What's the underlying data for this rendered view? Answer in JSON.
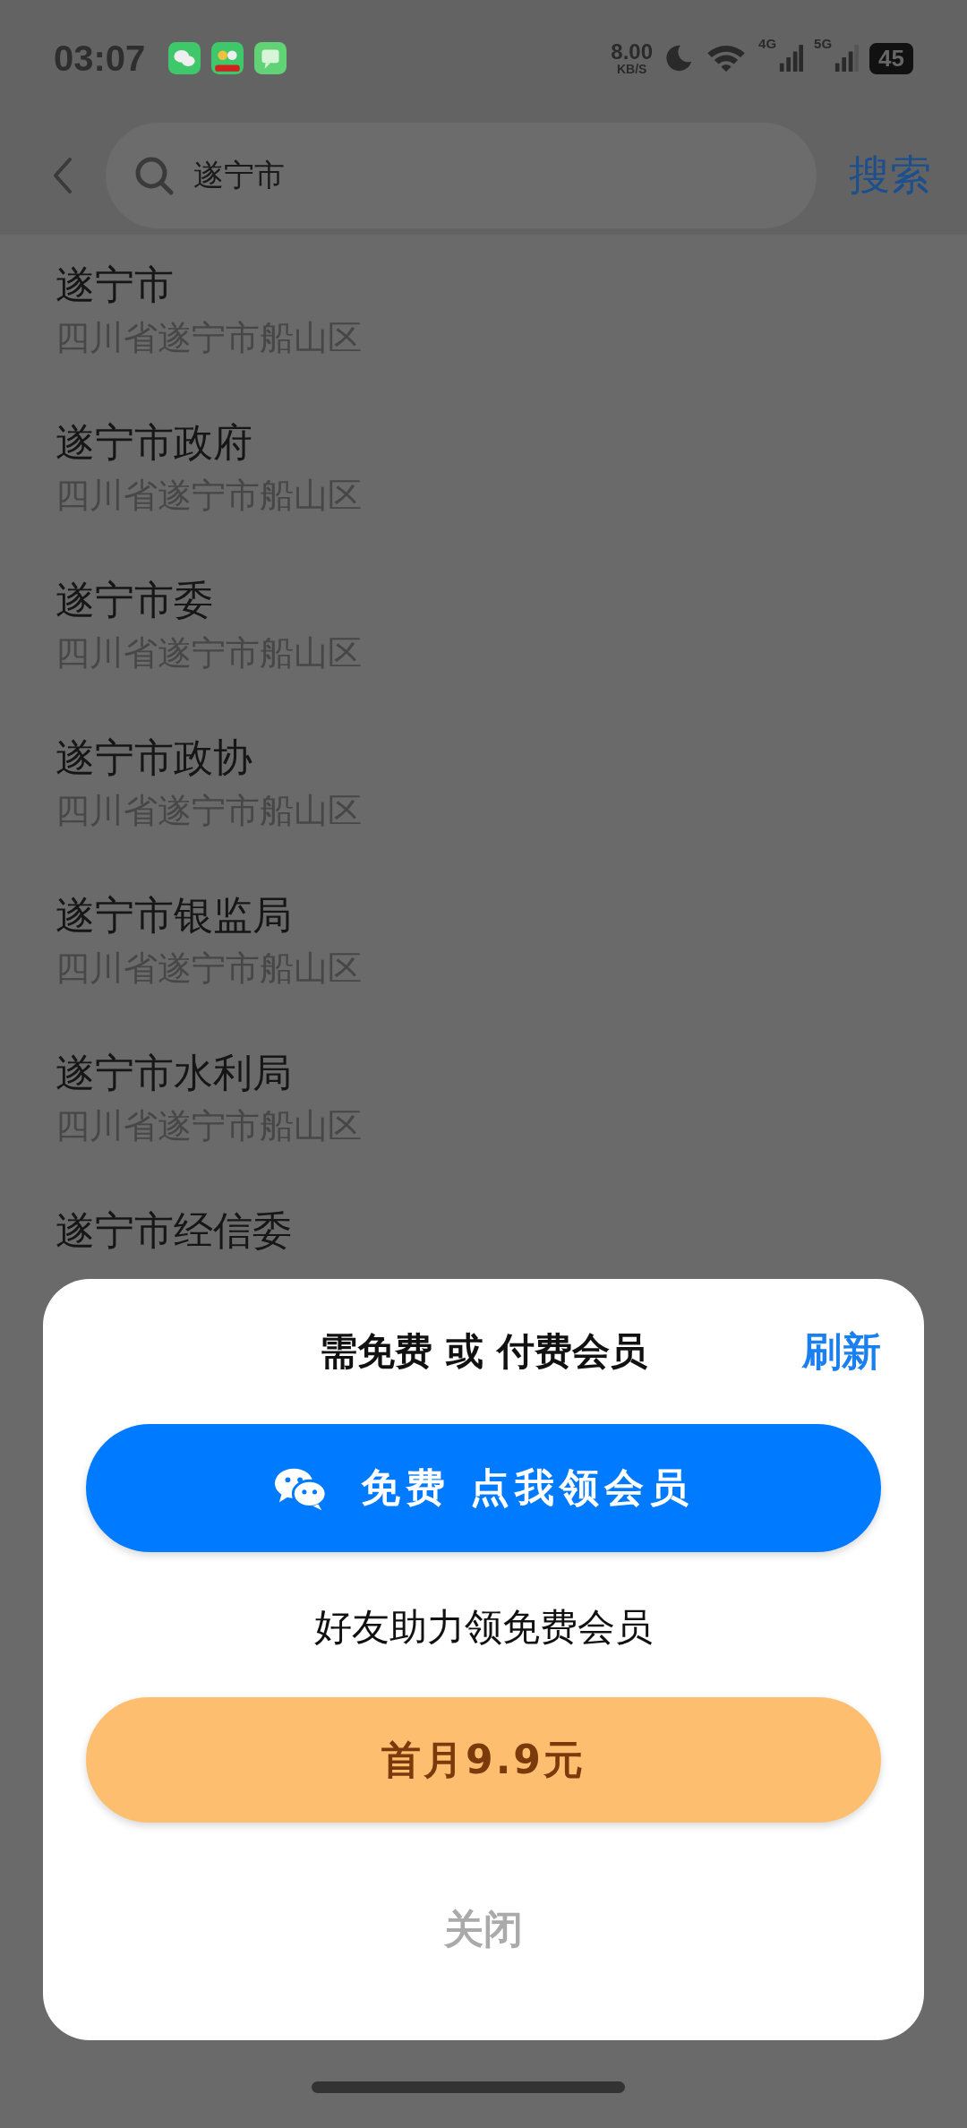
{
  "status_bar": {
    "time": "03:07",
    "speed": "8.00",
    "speed_unit": "KB/S",
    "network_1": "4G",
    "network_2": "5G",
    "battery": "45"
  },
  "search": {
    "value": "遂宁市",
    "button": "搜索"
  },
  "results": [
    {
      "name": "遂宁市",
      "address": "四川省遂宁市船山区"
    },
    {
      "name": "遂宁市政府",
      "address": "四川省遂宁市船山区"
    },
    {
      "name": "遂宁市委",
      "address": "四川省遂宁市船山区"
    },
    {
      "name": "遂宁市政协",
      "address": "四川省遂宁市船山区"
    },
    {
      "name": "遂宁市银监局",
      "address": "四川省遂宁市船山区"
    },
    {
      "name": "遂宁市水利局",
      "address": "四川省遂宁市船山区"
    },
    {
      "name": "遂宁市经信委"
    }
  ],
  "dialog": {
    "title": "需免费 或 付费会员",
    "refresh": "刷新",
    "free_button": "免费 点我领会员",
    "hint": "好友助力领免费会员",
    "paid_button": "首月9.9元",
    "close": "关闭"
  }
}
